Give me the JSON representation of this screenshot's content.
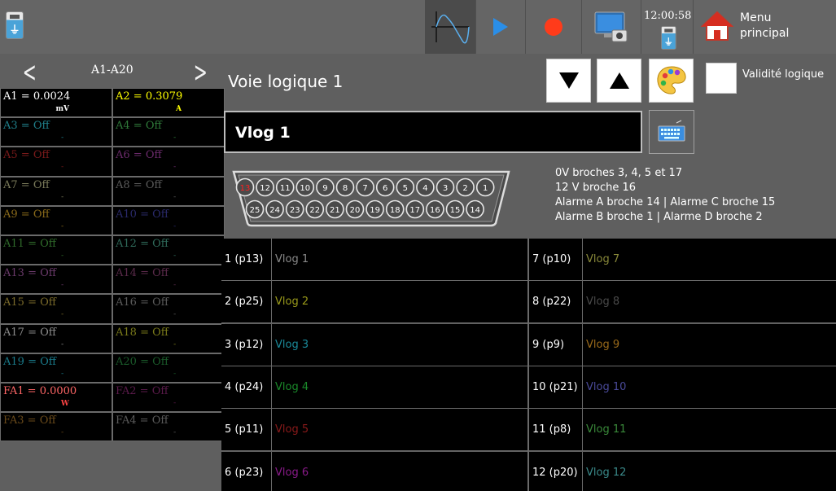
{
  "topbar": {
    "clock_time": "12:00:58",
    "menu_label_line1": "Menu",
    "menu_label_line2": "principal",
    "icons": [
      "usb-icon",
      "waveform-icon",
      "play-icon",
      "record-icon",
      "screen-capture-icon",
      "usb-icon",
      "home-icon"
    ]
  },
  "leftnav": {
    "prev": "<",
    "next": ">",
    "title": "A1-A20"
  },
  "channels": [
    {
      "label": "A1 = 0.0024",
      "unit": "mV",
      "color": "#ffffff",
      "unit_color": "#ffffff"
    },
    {
      "label": "A2 = 0.3079",
      "unit": "A",
      "color": "#ffff00",
      "unit_color": "#ffff00"
    },
    {
      "label": "A3 = Off",
      "unit": "-",
      "color": "#1f7f8a"
    },
    {
      "label": "A4 = Off",
      "unit": "-",
      "color": "#2f7a3a"
    },
    {
      "label": "A5 = Off",
      "unit": "-",
      "color": "#7a1a1a"
    },
    {
      "label": "A6 = Off",
      "unit": "-",
      "color": "#6a2a6a"
    },
    {
      "label": "A7 = Off",
      "unit": "-",
      "color": "#7a7a5a"
    },
    {
      "label": "A8 = Off",
      "unit": "-",
      "color": "#5a5a5a"
    },
    {
      "label": "A9 = Off",
      "unit": "-",
      "color": "#8a6a1a"
    },
    {
      "label": "A10 = Off",
      "unit": "-",
      "color": "#2a2a6a"
    },
    {
      "label": "A11 = Off",
      "unit": "-",
      "color": "#2f6a2a"
    },
    {
      "label": "A12 = Off",
      "unit": "-",
      "color": "#2f6a5a"
    },
    {
      "label": "A13 = Off",
      "unit": "-",
      "color": "#6a3a6a"
    },
    {
      "label": "A14 = Off",
      "unit": "-",
      "color": "#5a2a4a"
    },
    {
      "label": "A15 = Off",
      "unit": "-",
      "color": "#7a6a2a"
    },
    {
      "label": "A16 = Off",
      "unit": "-",
      "color": "#5a5a5a"
    },
    {
      "label": "A17 = Off",
      "unit": "-",
      "color": "#8a8a8a"
    },
    {
      "label": "A18 = Off",
      "unit": "-",
      "color": "#7a7a1a"
    },
    {
      "label": "A19 = Off",
      "unit": "-",
      "color": "#1a7a8a"
    },
    {
      "label": "A20 = Off",
      "unit": "-",
      "color": "#1a5a2a"
    },
    {
      "label": "FA1 = 0.0000",
      "unit": "W",
      "color": "#ff6666",
      "unit_color": "#ff4444"
    },
    {
      "label": "FA2 = Off",
      "unit": "-",
      "color": "#5a1a4a"
    },
    {
      "label": "FA3 = Off",
      "unit": "-",
      "color": "#6a4a1a"
    },
    {
      "label": "FA4 = Off",
      "unit": "-",
      "color": "#5a5a5a"
    }
  ],
  "main": {
    "title": "Voie logique 1",
    "validity_label": "Validité logique",
    "name_value": "Vlog  1",
    "pin_info": [
      "0V broches 3, 4, 5 et 17",
      "12 V broche  16",
      "Alarme A broche 14 | Alarme C broche 15",
      "Alarme B broche 1 | Alarme D broche 2"
    ],
    "connector_top": [
      "13",
      "12",
      "11",
      "10",
      "9",
      "8",
      "7",
      "6",
      "5",
      "4",
      "3",
      "2",
      "1"
    ],
    "connector_bottom": [
      "25",
      "24",
      "23",
      "22",
      "21",
      "20",
      "19",
      "18",
      "17",
      "16",
      "15",
      "14"
    ],
    "highlighted_pin": "13"
  },
  "logic_table": {
    "left": [
      {
        "idx": "1 (p13)",
        "name": "Vlog  1",
        "color": "#8a8a8a"
      },
      {
        "idx": "2 (p25)",
        "name": "Vlog  2",
        "color": "#9a9a1a"
      },
      {
        "idx": "3 (p12)",
        "name": "Vlog  3",
        "color": "#1a8a9a"
      },
      {
        "idx": "4 (p24)",
        "name": "Vlog  4",
        "color": "#1a8a2a"
      },
      {
        "idx": "5 (p11)",
        "name": "Vlog  5",
        "color": "#8a1a1a"
      },
      {
        "idx": "6 (p23)",
        "name": "Vlog  6",
        "color": "#8a1a8a"
      }
    ],
    "right": [
      {
        "idx": "7 (p10)",
        "name": "Vlog  7",
        "color": "#8a8a3a"
      },
      {
        "idx": "8 (p22)",
        "name": "Vlog  8",
        "color": "#4a4a4a"
      },
      {
        "idx": "9 (p9)",
        "name": "Vlog  9",
        "color": "#9a6a1a"
      },
      {
        "idx": "10 (p21)",
        "name": "Vlog 10",
        "color": "#4a4a9a"
      },
      {
        "idx": "11 (p8)",
        "name": "Vlog 11",
        "color": "#3a8a3a"
      },
      {
        "idx": "12 (p20)",
        "name": "Vlog 12",
        "color": "#3a8a8a"
      }
    ]
  }
}
